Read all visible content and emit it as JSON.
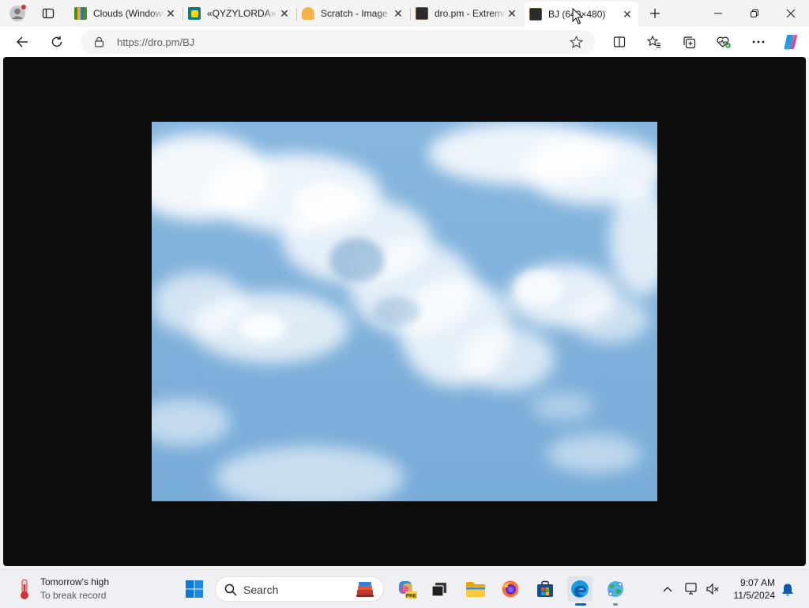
{
  "tabs": [
    {
      "title": "Clouds (Windows",
      "favicon": "clouds-grid-icon"
    },
    {
      "title": "«QYZYLORDA»",
      "favicon": "teal-square-icon"
    },
    {
      "title": "Scratch - Image",
      "favicon": "scratch-cat-icon"
    },
    {
      "title": "dro.pm - Extreme",
      "favicon": "dro-pm-icon"
    },
    {
      "title": "BJ (640×480)",
      "favicon": "dro-pm-icon",
      "active": true
    }
  ],
  "address": {
    "url": "https://dro.pm/BJ"
  },
  "taskbar": {
    "weather_title": "Tomorrow's high",
    "weather_subtitle": "To break record",
    "search_label": "Search",
    "time": "9:07 AM",
    "date": "11/5/2024",
    "copilot_badge": "PRE"
  },
  "colors": {
    "sky": "#7aaed8",
    "page_background": "#0d0d0d",
    "chrome": "#f3f3f3",
    "taskbar": "#eef0f4",
    "accent": "#0067c0"
  }
}
